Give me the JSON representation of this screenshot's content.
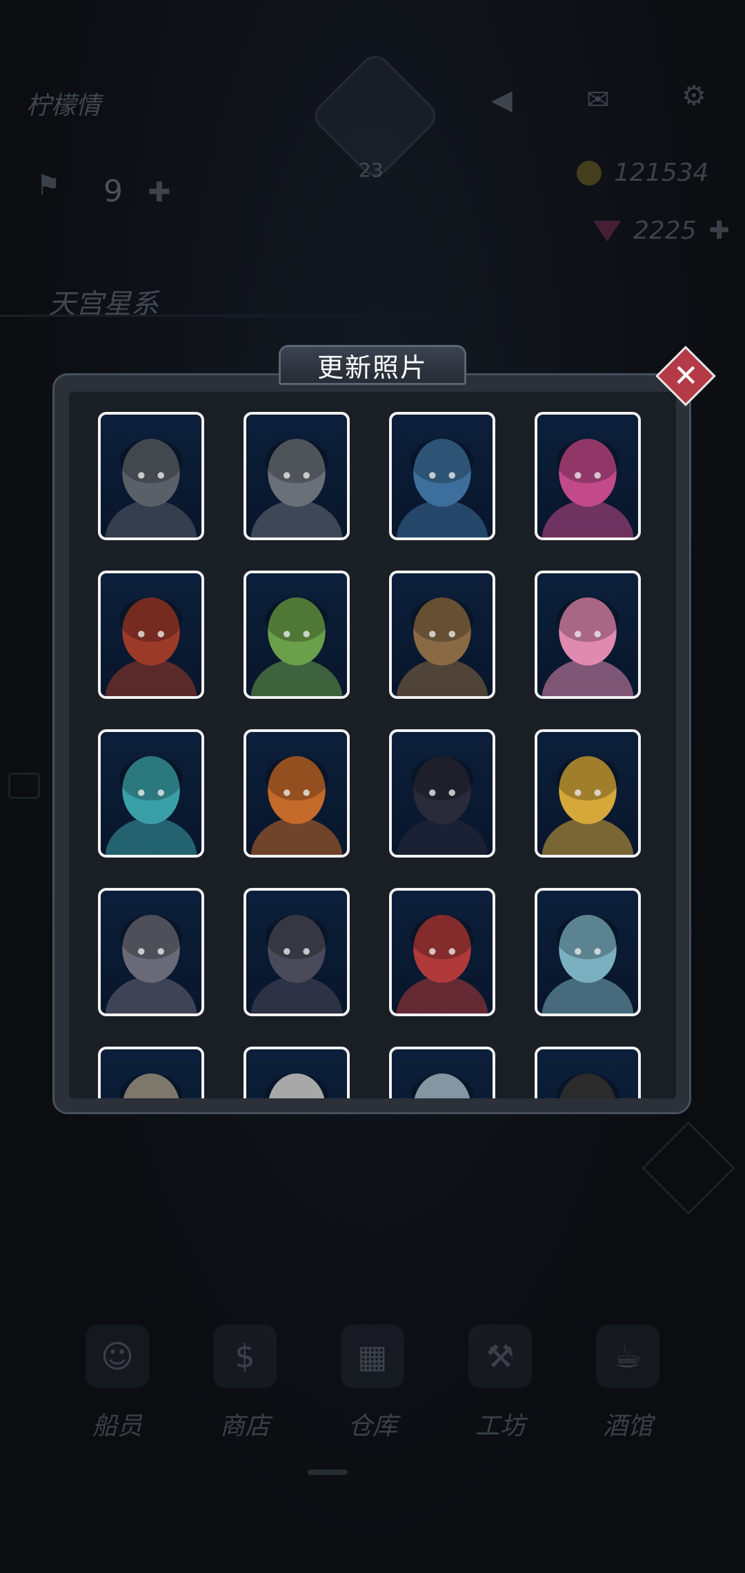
{
  "background": {
    "player_name": "柠檬情",
    "avatar_level": "23",
    "crew_count": "9",
    "gold": "121534",
    "gems": "2225",
    "galaxy_name": "天宫星系",
    "nav": [
      {
        "label": "船员",
        "icon": "crew-icon"
      },
      {
        "label": "商店",
        "icon": "shop-icon"
      },
      {
        "label": "仓库",
        "icon": "warehouse-icon"
      },
      {
        "label": "工坊",
        "icon": "workshop-icon"
      },
      {
        "label": "酒馆",
        "icon": "tavern-icon"
      }
    ]
  },
  "modal": {
    "title": "更新照片",
    "close_icon": "✕",
    "portraits": [
      {
        "name": "robot-helmet-1",
        "color": "#5a5f68"
      },
      {
        "name": "robot-helmet-2",
        "color": "#6a6f78"
      },
      {
        "name": "blue-goblin-pirate",
        "color": "#3d6f9c"
      },
      {
        "name": "pink-hair-girl",
        "color": "#c24a8a"
      },
      {
        "name": "goggles-scarf-man",
        "color": "#9c3a2a"
      },
      {
        "name": "green-alien",
        "color": "#6aa04a"
      },
      {
        "name": "bearded-dwarf",
        "color": "#8a6a44"
      },
      {
        "name": "pink-cap-girl",
        "color": "#e08ab0"
      },
      {
        "name": "diving-helmet",
        "color": "#3aa0a8"
      },
      {
        "name": "pug-astronaut",
        "color": "#c46a2a"
      },
      {
        "name": "dark-hair-woman",
        "color": "#2a2a3a"
      },
      {
        "name": "blonde-man",
        "color": "#d6a83a"
      },
      {
        "name": "hooded-figure",
        "color": "#6a6a78"
      },
      {
        "name": "top-hat-robot",
        "color": "#4a4a5a"
      },
      {
        "name": "red-helmet-brute",
        "color": "#b03a3a"
      },
      {
        "name": "horned-elf",
        "color": "#7ab0c0"
      },
      {
        "name": "partial-1",
        "color": "#a8a090"
      },
      {
        "name": "partial-2",
        "color": "#e0e0e0"
      },
      {
        "name": "partial-3",
        "color": "#b0c8d8"
      },
      {
        "name": "partial-4",
        "color": "#3a3a3a"
      }
    ]
  }
}
